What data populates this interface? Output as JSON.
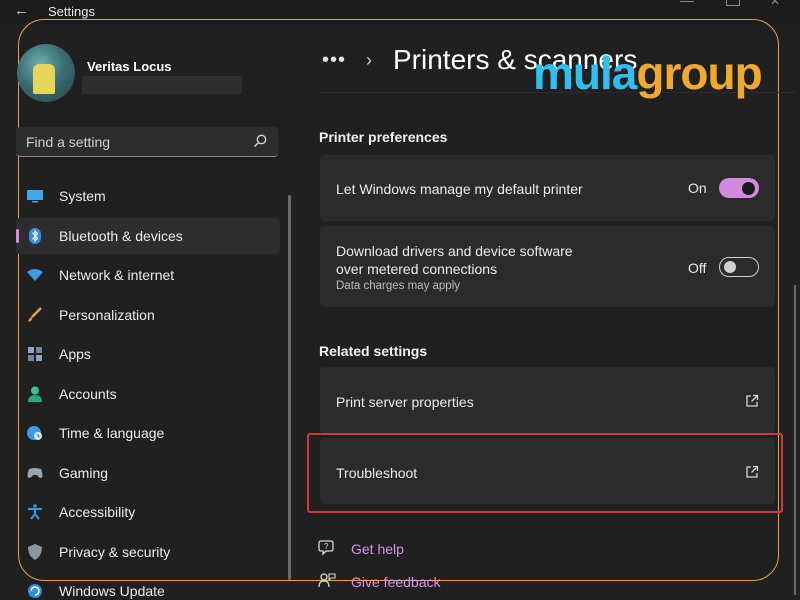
{
  "window": {
    "title": "Settings"
  },
  "user": {
    "name": "Veritas Locus"
  },
  "search": {
    "placeholder": "Find a setting"
  },
  "nav": {
    "items": [
      {
        "label": "System",
        "icon": "monitor-icon"
      },
      {
        "label": "Bluetooth & devices",
        "icon": "bluetooth-icon",
        "active": true
      },
      {
        "label": "Network & internet",
        "icon": "wifi-icon"
      },
      {
        "label": "Personalization",
        "icon": "brush-icon"
      },
      {
        "label": "Apps",
        "icon": "apps-icon"
      },
      {
        "label": "Accounts",
        "icon": "person-icon"
      },
      {
        "label": "Time & language",
        "icon": "clock-globe-icon"
      },
      {
        "label": "Gaming",
        "icon": "gamepad-icon"
      },
      {
        "label": "Accessibility",
        "icon": "accessibility-icon"
      },
      {
        "label": "Privacy & security",
        "icon": "shield-icon"
      },
      {
        "label": "Windows Update",
        "icon": "update-icon"
      }
    ]
  },
  "header": {
    "breadcrumb_ellipsis": "•••",
    "chevron": "›",
    "title": "Printers & scanners"
  },
  "watermark": {
    "part1": "mula",
    "part2": "group"
  },
  "printer_preferences": {
    "heading": "Printer preferences",
    "manage_default": {
      "label": "Let Windows manage my default printer",
      "state": "On"
    },
    "metered": {
      "label_line1": "Download drivers and device software",
      "label_line2": "over metered connections",
      "sublabel": "Data charges may apply",
      "state": "Off"
    }
  },
  "related_settings": {
    "heading": "Related settings",
    "items": [
      {
        "label": "Print server properties",
        "icon": "open-external-icon"
      },
      {
        "label": "Troubleshoot",
        "icon": "open-external-icon"
      }
    ]
  },
  "footer_links": [
    {
      "label": "Get help",
      "icon": "help-icon"
    },
    {
      "label": "Give feedback",
      "icon": "feedback-icon"
    }
  ],
  "colors": {
    "accent": "#d08be0",
    "background": "#202020",
    "card": "#2b2b2b",
    "highlight": "#d6363a",
    "frame": "#e8a33d",
    "brand_blue": "#2fc0f2",
    "brand_orange": "#f0a92e"
  }
}
